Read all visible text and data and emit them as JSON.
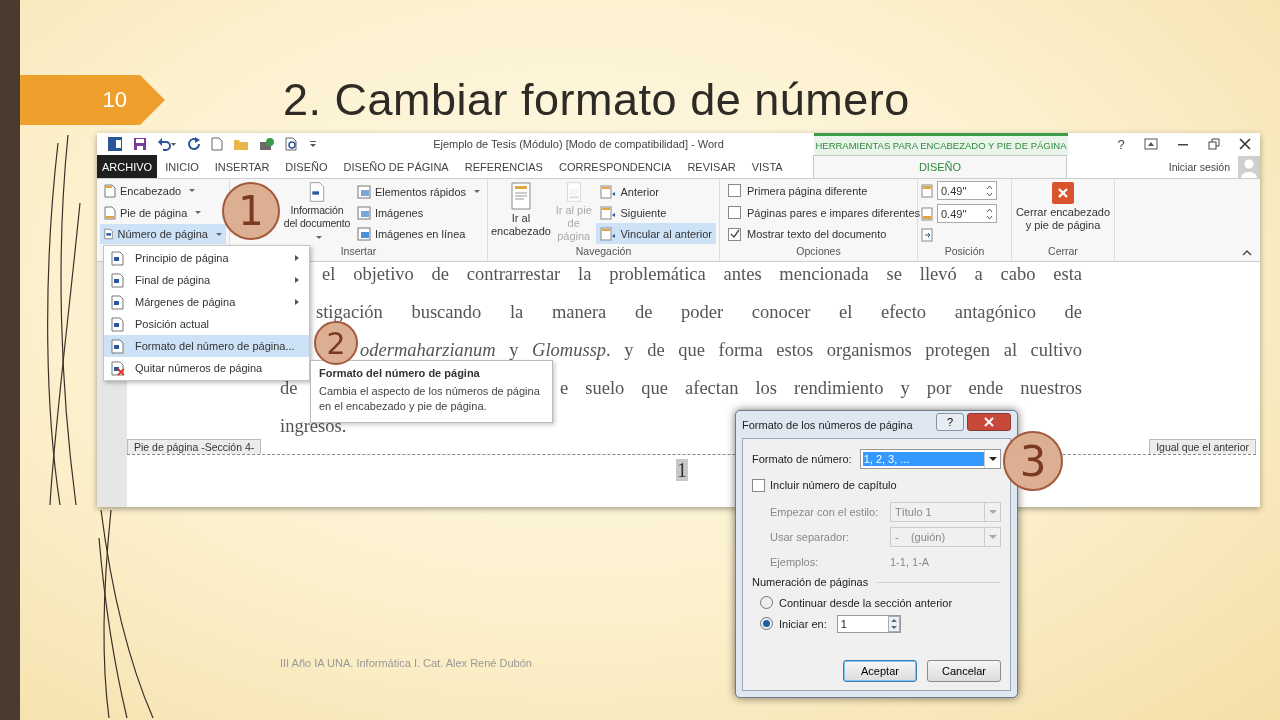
{
  "slide": {
    "number": "10",
    "title": "2. Cambiar formato de número",
    "footer": "III Año IA UNA. Informática I. Cat. Alex René Dubón"
  },
  "word": {
    "title": "Ejemplo de Tesis (Módulo) [Modo de compatibilidad] - Word",
    "help": "?",
    "contextual_header": "HERRAMIENTAS PARA ENCABEZADO Y PIE DE PÁGINA",
    "tabs": [
      {
        "label": "ARCHIVO",
        "kind": "file",
        "selected": false
      },
      {
        "label": "INICIO",
        "kind": "main",
        "selected": false
      },
      {
        "label": "INSERTAR",
        "kind": "main",
        "selected": false
      },
      {
        "label": "DISEÑO",
        "kind": "main",
        "selected": false
      },
      {
        "label": "DISEÑO DE PÁGINA",
        "kind": "main",
        "selected": false
      },
      {
        "label": "REFERENCIAS",
        "kind": "main",
        "selected": false
      },
      {
        "label": "CORRESPONDENCIA",
        "kind": "main",
        "selected": false
      },
      {
        "label": "REVISAR",
        "kind": "main",
        "selected": false
      },
      {
        "label": "VISTA",
        "kind": "main",
        "selected": false
      },
      {
        "label": "DISEÑO",
        "kind": "contextual",
        "selected": true
      }
    ],
    "account": "Iniciar sesión",
    "ribbon": {
      "header_footer": [
        {
          "label": "Encabezado",
          "selected": false
        },
        {
          "label": "Pie de página",
          "selected": false
        },
        {
          "label": "Número de página",
          "selected": true
        }
      ],
      "insert": {
        "label": "Insertar",
        "document_info": "Información del documento",
        "items": [
          {
            "label": "Elementos rápidos",
            "dropdown": true
          },
          {
            "label": "Imágenes",
            "dropdown": false
          },
          {
            "label": "Imágenes en línea",
            "dropdown": false
          }
        ]
      },
      "navigation": {
        "label": "Navegación",
        "big": [
          {
            "label": "Ir al encabezado",
            "disabled": false
          },
          {
            "label": "Ir al pie de página",
            "disabled": true
          }
        ],
        "small": [
          {
            "label": "Anterior",
            "selected": false
          },
          {
            "label": "Siguiente",
            "selected": false
          },
          {
            "label": "Vincular al anterior",
            "selected": true
          }
        ]
      },
      "options": {
        "label": "Opciones",
        "items": [
          {
            "label": "Primera página diferente",
            "checked": false
          },
          {
            "label": "Páginas pares e impares diferentes",
            "checked": false
          },
          {
            "label": "Mostrar texto del documento",
            "checked": true
          }
        ]
      },
      "position": {
        "label": "Posición",
        "fields": [
          "0.49\"",
          "0.49\""
        ]
      },
      "close": {
        "label": "Cerrar",
        "button": "Cerrar encabezado y pie de página"
      }
    },
    "document": {
      "lines": [
        [
          "el objetivo de contrarrestar la problemática antes mencionada se llevó a cabo esta"
        ],
        [
          "stigación buscando la manera de  poder conocer el efecto antagónico de"
        ],
        [
          "*odermaharzianum* y *Glomussp*. y de que forma estos organismos protegen al cultivo"
        ],
        [
          "de",
          "e suelo que afectan los rendimiento y por ende nuestros"
        ],
        [
          "ingresos."
        ]
      ],
      "footer_tag": "Pie de página -Sección 4-",
      "same_as_previous": "Igual que el anterior",
      "page_number": "1"
    }
  },
  "page_number_menu": [
    {
      "label": "Principio de página",
      "submenu": true,
      "selected": false
    },
    {
      "label": "Final de página",
      "submenu": true,
      "selected": false
    },
    {
      "label": "Márgenes de página",
      "submenu": true,
      "selected": false
    },
    {
      "label": "Posición actual",
      "submenu": false,
      "selected": false
    },
    {
      "label": "Formato del número de página...",
      "submenu": false,
      "selected": true
    },
    {
      "label": "Quitar números de página",
      "submenu": false,
      "selected": false
    }
  ],
  "tooltip": {
    "title": "Formato del número de página",
    "text": "Cambia el aspecto de los números de página en el encabezado y pie de página."
  },
  "dialog": {
    "title": "Formato de los números de página",
    "help": "?",
    "number_format": {
      "label": "Formato de número:",
      "value": "1, 2, 3, ..."
    },
    "include_chapter": {
      "label": "Incluir número de capítulo",
      "checked": false
    },
    "chapter_style": {
      "label": "Empezar con el estilo:",
      "value": "Título 1",
      "disabled": true
    },
    "separator": {
      "label": "Usar separador:",
      "value": "-    (guión)",
      "disabled": true
    },
    "examples": {
      "label": "Ejemplos:",
      "value": "1-1, 1-A",
      "disabled": true
    },
    "numbering": {
      "label": "Numeración de páginas",
      "options": [
        {
          "label": "Continuar desde la sección anterior",
          "selected": false
        },
        {
          "label": "Iniciar en:",
          "selected": true
        }
      ],
      "start_at": "1"
    },
    "buttons": [
      "Aceptar",
      "Cancelar"
    ]
  },
  "callouts": [
    "1",
    "2",
    "3"
  ]
}
